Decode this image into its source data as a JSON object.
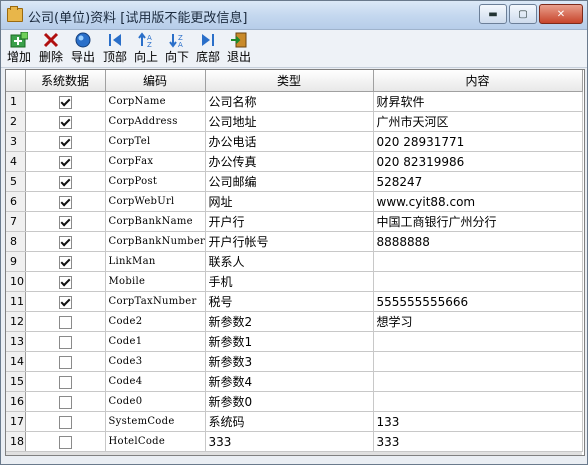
{
  "window": {
    "title": "公司(单位)资料 [试用版不能更改信息]",
    "buttons": {
      "minimize": "▬",
      "maximize": "▢",
      "close": "✕"
    }
  },
  "toolbar": [
    {
      "label": "增加",
      "icon": "add-icon",
      "color": "#1e9c2a"
    },
    {
      "label": "删除",
      "icon": "delete-icon",
      "color": "#b01010"
    },
    {
      "label": "导出",
      "icon": "export-icon",
      "color": "#2a6fc9"
    },
    {
      "label": "顶部",
      "icon": "top-icon",
      "color": "#2a6fc9"
    },
    {
      "label": "向上",
      "icon": "up-icon",
      "color": "#2a6fc9"
    },
    {
      "label": "向下",
      "icon": "down-icon",
      "color": "#2a6fc9"
    },
    {
      "label": "底部",
      "icon": "bottom-icon",
      "color": "#2a6fc9"
    },
    {
      "label": "退出",
      "icon": "exit-icon",
      "color": "#3a8a2a"
    }
  ],
  "table": {
    "headers": [
      "",
      "系统数据",
      "编码",
      "类型",
      "内容"
    ],
    "rows": [
      {
        "n": "1",
        "sys": true,
        "code": "CorpName",
        "type": "公司名称",
        "content": "财昇软件"
      },
      {
        "n": "2",
        "sys": true,
        "code": "CorpAddress",
        "type": "公司地址",
        "content": "广州市天河区"
      },
      {
        "n": "3",
        "sys": true,
        "code": "CorpTel",
        "type": "办公电话",
        "content": "020 28931771"
      },
      {
        "n": "4",
        "sys": true,
        "code": "CorpFax",
        "type": "办公传真",
        "content": "020 82319986"
      },
      {
        "n": "5",
        "sys": true,
        "code": "CorpPost",
        "type": "公司邮编",
        "content": "528247"
      },
      {
        "n": "6",
        "sys": true,
        "code": "CorpWebUrl",
        "type": "网址",
        "content": "www.cyit88.com"
      },
      {
        "n": "7",
        "sys": true,
        "code": "CorpBankName",
        "type": "开户行",
        "content": "中国工商银行广州分行"
      },
      {
        "n": "8",
        "sys": true,
        "code": "CorpBankNumber",
        "type": "开户行帐号",
        "content": "8888888"
      },
      {
        "n": "9",
        "sys": true,
        "code": "LinkMan",
        "type": "联系人",
        "content": ""
      },
      {
        "n": "10",
        "sys": true,
        "code": "Mobile",
        "type": "手机",
        "content": ""
      },
      {
        "n": "11",
        "sys": true,
        "code": "CorpTaxNumber",
        "type": "税号",
        "content": "555555555666"
      },
      {
        "n": "12",
        "sys": false,
        "code": "Code2",
        "type": "新参数2",
        "content": "想学习"
      },
      {
        "n": "13",
        "sys": false,
        "code": "Code1",
        "type": "新参数1",
        "content": ""
      },
      {
        "n": "14",
        "sys": false,
        "code": "Code3",
        "type": "新参数3",
        "content": ""
      },
      {
        "n": "15",
        "sys": false,
        "code": "Code4",
        "type": "新参数4",
        "content": ""
      },
      {
        "n": "16",
        "sys": false,
        "code": "Code0",
        "type": "新参数0",
        "content": ""
      },
      {
        "n": "17",
        "sys": false,
        "code": "SystemCode",
        "type": "系统码",
        "content": "133"
      },
      {
        "n": "18",
        "sys": false,
        "code": "HotelCode",
        "type": "333",
        "content": "333"
      }
    ]
  }
}
